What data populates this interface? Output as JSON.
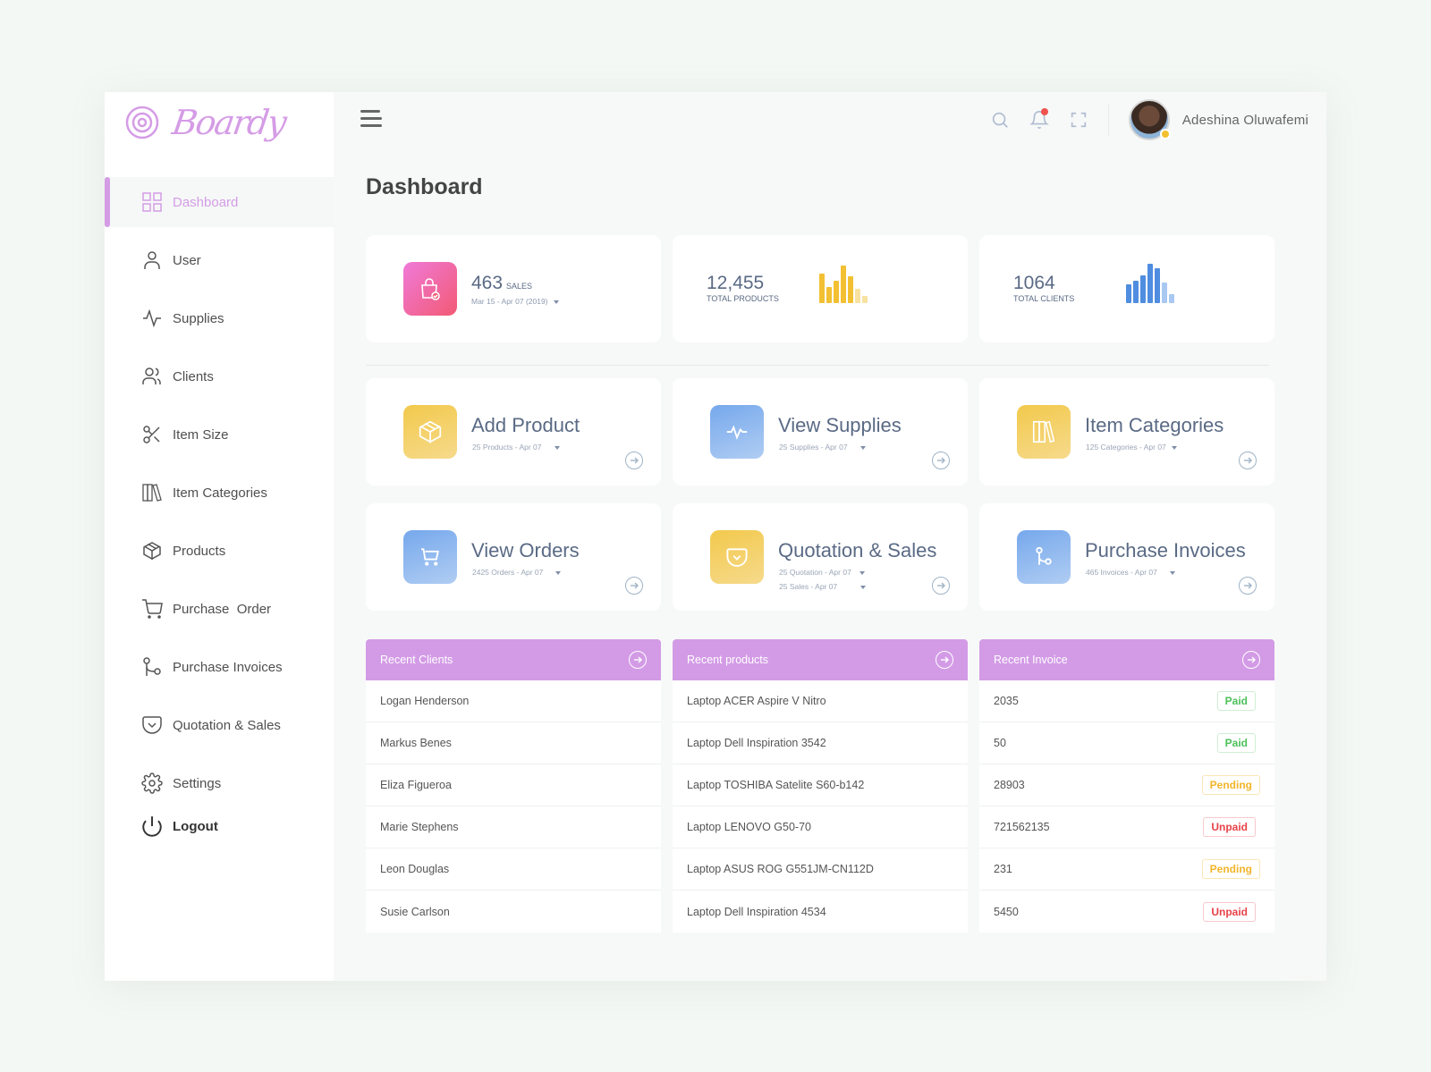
{
  "brand": {
    "name": "Boardy",
    "accent": "#d59ce6"
  },
  "sidebar": {
    "items": [
      {
        "label": "Dashboard",
        "icon": "grid-icon",
        "active": true
      },
      {
        "label": "User",
        "icon": "user-icon"
      },
      {
        "label": "Supplies",
        "icon": "activity-icon"
      },
      {
        "label": "Clients",
        "icon": "users-icon"
      },
      {
        "label": "Item Size",
        "icon": "scissors-icon"
      },
      {
        "label": "Item Categories",
        "icon": "books-icon"
      },
      {
        "label": "Products",
        "icon": "box-icon"
      },
      {
        "label": "Purchase  Order",
        "icon": "cart-icon"
      },
      {
        "label": "Purchase Invoices",
        "icon": "branch-icon"
      },
      {
        "label": "Quotation & Sales",
        "icon": "pocket-icon"
      },
      {
        "label": "Settings",
        "icon": "gear-icon"
      }
    ],
    "logout_label": "Logout"
  },
  "header": {
    "username": "Adeshina Oluwafemi",
    "has_notification": true
  },
  "page": {
    "title": "Dashboard"
  },
  "stats": {
    "sales": {
      "value": "463",
      "unit": "SALES",
      "range": "Mar 15 - Apr 07 (2019)"
    },
    "products": {
      "value": "12,455",
      "label": "TOTAL PRODUCTS",
      "bars": [
        0.72,
        0.4,
        0.55,
        0.92,
        0.66,
        0.35,
        0.18
      ],
      "color": "#f2c032",
      "light": "#f8e2a0"
    },
    "clients": {
      "value": "1064",
      "label": "TOTAL CLIENTS",
      "bars": [
        0.45,
        0.55,
        0.68,
        0.95,
        0.85,
        0.5,
        0.22
      ],
      "color": "#4f8de0",
      "light": "#a9c8f2"
    }
  },
  "actions": [
    {
      "title": "Add Product",
      "subs": [
        "25 Products - Apr 07"
      ]
    },
    {
      "title": "View Supplies",
      "subs": [
        "25 Supplies - Apr 07"
      ]
    },
    {
      "title": "Item Categories",
      "subs": [
        "125 Categories - Apr 07"
      ]
    },
    {
      "title": "View Orders",
      "subs": [
        "2425 Orders - Apr 07"
      ]
    },
    {
      "title": "Quotation & Sales",
      "subs": [
        "25 Quotation - Apr 07",
        "25 Sales - Apr 07"
      ]
    },
    {
      "title": "Purchase Invoices",
      "subs": [
        "465 Invoices - Apr 07"
      ]
    }
  ],
  "panels": {
    "clients": {
      "title": "Recent Clients",
      "rows": [
        "Logan Henderson",
        "Markus Benes",
        "Eliza Figueroa",
        "Marie Stephens",
        "Leon Douglas",
        "Susie Carlson"
      ]
    },
    "products": {
      "title": "Recent products",
      "rows": [
        "Laptop ACER Aspire V Nitro",
        "Laptop Dell Inspiration 3542",
        "Laptop TOSHIBA Satelite S60-b142",
        "Laptop LENOVO G50-70",
        "Laptop ASUS ROG G551JM-CN112D",
        "Laptop Dell Inspiration 4534"
      ]
    },
    "invoices": {
      "title": "Recent Invoice",
      "rows": [
        {
          "number": "2035",
          "status": "Paid"
        },
        {
          "number": "50",
          "status": "Paid"
        },
        {
          "number": "28903",
          "status": "Pending"
        },
        {
          "number": "721562135",
          "status": "Unpaid"
        },
        {
          "number": "231",
          "status": "Pending"
        },
        {
          "number": "5450",
          "status": "Unpaid"
        }
      ]
    }
  },
  "status_colors": {
    "Paid": "#4cc05a",
    "Pending": "#f2b52a",
    "Unpaid": "#e8424a"
  }
}
